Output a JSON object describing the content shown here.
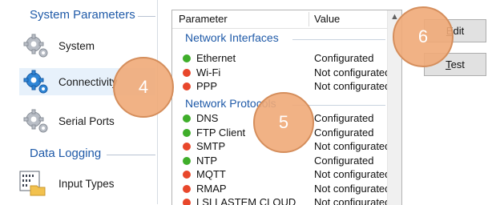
{
  "sidebar": {
    "sections": [
      {
        "title": "System Parameters"
      },
      {
        "title": "Data Logging"
      }
    ],
    "items": [
      {
        "label": "System",
        "icon": "gear-icon"
      },
      {
        "label": "Connectivity",
        "icon": "gear-blue-icon",
        "selected": true
      },
      {
        "label": "Serial Ports",
        "icon": "gear-icon"
      },
      {
        "label": "Input Types",
        "icon": "binary-folder-icon"
      }
    ]
  },
  "list": {
    "columns": {
      "parameter": "Parameter",
      "value": "Value"
    },
    "groups": [
      {
        "title": "Network Interfaces",
        "rows": [
          {
            "name": "Ethernet",
            "value": "Configurated",
            "status": "green"
          },
          {
            "name": "Wi-Fi",
            "value": "Not configurated",
            "status": "red"
          },
          {
            "name": "PPP",
            "value": "Not configurated",
            "status": "red"
          }
        ]
      },
      {
        "title": "Network Protocols",
        "rows": [
          {
            "name": "DNS",
            "value": "Configurated",
            "status": "green"
          },
          {
            "name": "FTP Client",
            "value": "Configurated",
            "status": "green"
          },
          {
            "name": "SMTP",
            "value": "Not configurated",
            "status": "red"
          },
          {
            "name": "NTP",
            "value": "Configurated",
            "status": "green"
          },
          {
            "name": "MQTT",
            "value": "Not configurated",
            "status": "red"
          },
          {
            "name": "RMAP",
            "value": "Not configurated",
            "status": "red"
          },
          {
            "name": "LSI LASTEM CLOUD",
            "value": "Not configurated",
            "status": "red"
          }
        ]
      }
    ]
  },
  "buttons": {
    "edit": {
      "underline": "E",
      "rest": "dit"
    },
    "test": {
      "underline": "T",
      "rest": "est"
    }
  },
  "callouts": [
    "4",
    "5",
    "6"
  ],
  "colors": {
    "accent": "#1f5aa8",
    "green": "#3fae2a",
    "red": "#e8472b",
    "callout": "#f0aa78"
  }
}
